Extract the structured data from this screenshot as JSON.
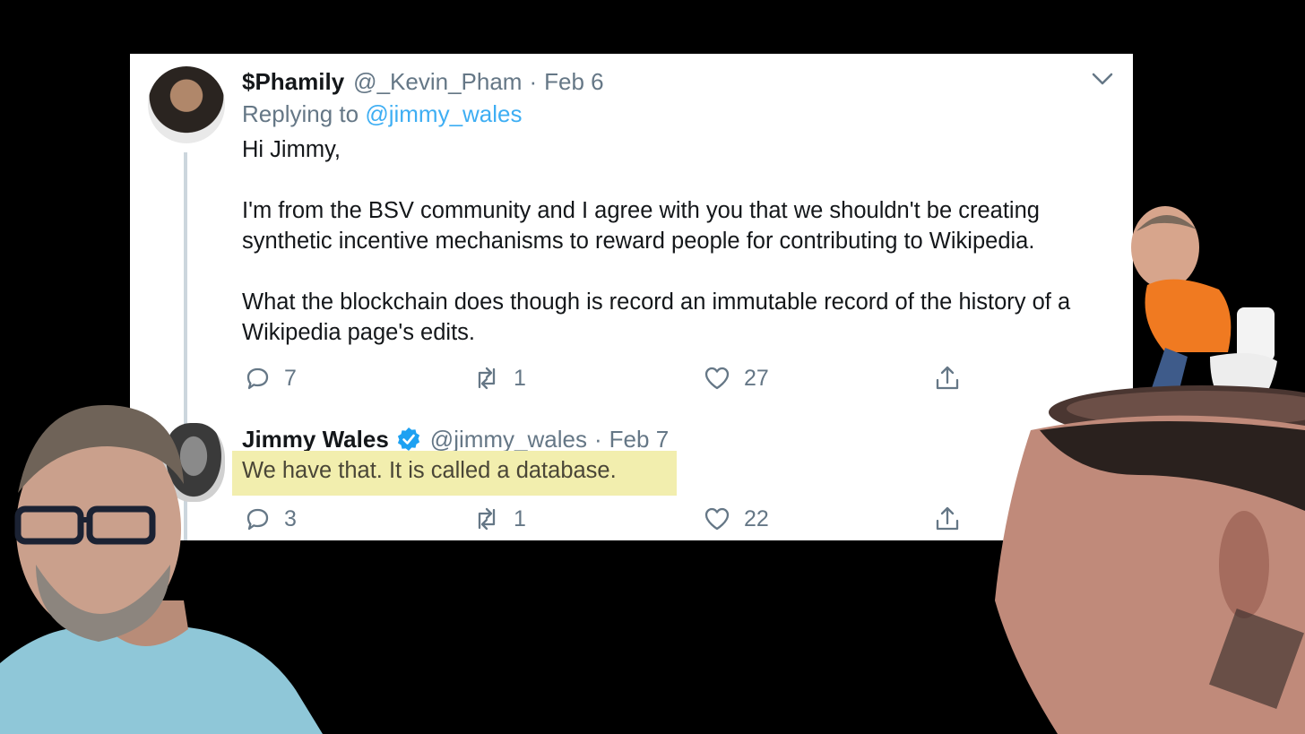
{
  "tweet1": {
    "name": "$Phamily",
    "handle": "@_Kevin_Pham",
    "date": "Feb 6",
    "replying_prefix": "Replying to",
    "replying_mention": "@jimmy_wales",
    "body": [
      "Hi Jimmy,",
      "I'm from the BSV community and I agree with you that we shouldn't be creating synthetic incentive mechanisms to reward people for contributing to Wikipedia.",
      "What the blockchain does though is record an immutable record of the history of a Wikipedia page's edits."
    ],
    "replies": "7",
    "retweets": "1",
    "likes": "27"
  },
  "tweet2": {
    "name": "Jimmy Wales",
    "handle": "@jimmy_wales",
    "date": "Feb 7",
    "body": "We have that. It is called a database.",
    "replies": "3",
    "retweets": "1",
    "likes": "22"
  },
  "separator": "·",
  "icons": {
    "reply": "reply-icon",
    "retweet": "retweet-icon",
    "like": "heart-icon",
    "share": "share-icon",
    "menu": "chevron-down-icon",
    "verified": "verified-badge-icon"
  },
  "colors": {
    "background": "#000000",
    "card": "#ffffff",
    "text": "#14171a",
    "muted": "#657786",
    "link": "#1da1f2",
    "highlight": "#f2eeae"
  }
}
